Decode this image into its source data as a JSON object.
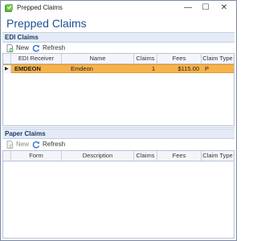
{
  "window": {
    "title": "Prepped Claims",
    "min_glyph": "—",
    "max_glyph": "☐",
    "close_glyph": "✕",
    "icon": "app-icon"
  },
  "page": {
    "heading": "Prepped Claims"
  },
  "edi": {
    "header": "EDI Claims",
    "toolbar": {
      "new_label": "New",
      "refresh_label": "Refresh",
      "new_icon": "new-document-icon",
      "refresh_icon": "refresh-icon"
    },
    "columns": [
      "EDI Receiver",
      "Name",
      "Claims",
      "Fees",
      "Claim Type"
    ],
    "rows": [
      {
        "receiver": "EMDEON",
        "name": "Emdeon",
        "claims": "1",
        "fees": "$115.00",
        "claim_type": "P",
        "selected": true
      }
    ],
    "row_indicator": "▶"
  },
  "paper": {
    "header": "Paper Claims",
    "toolbar": {
      "new_label": "New",
      "refresh_label": "Refresh",
      "new_icon": "new-document-icon",
      "refresh_icon": "refresh-icon"
    },
    "columns": [
      "Form",
      "Description",
      "Claims",
      "Fees",
      "Claim Type"
    ],
    "rows": []
  },
  "colors": {
    "accent": "#1f4f99",
    "selected_row": "#f8b24a",
    "panel_header": "#e4ebf6"
  }
}
